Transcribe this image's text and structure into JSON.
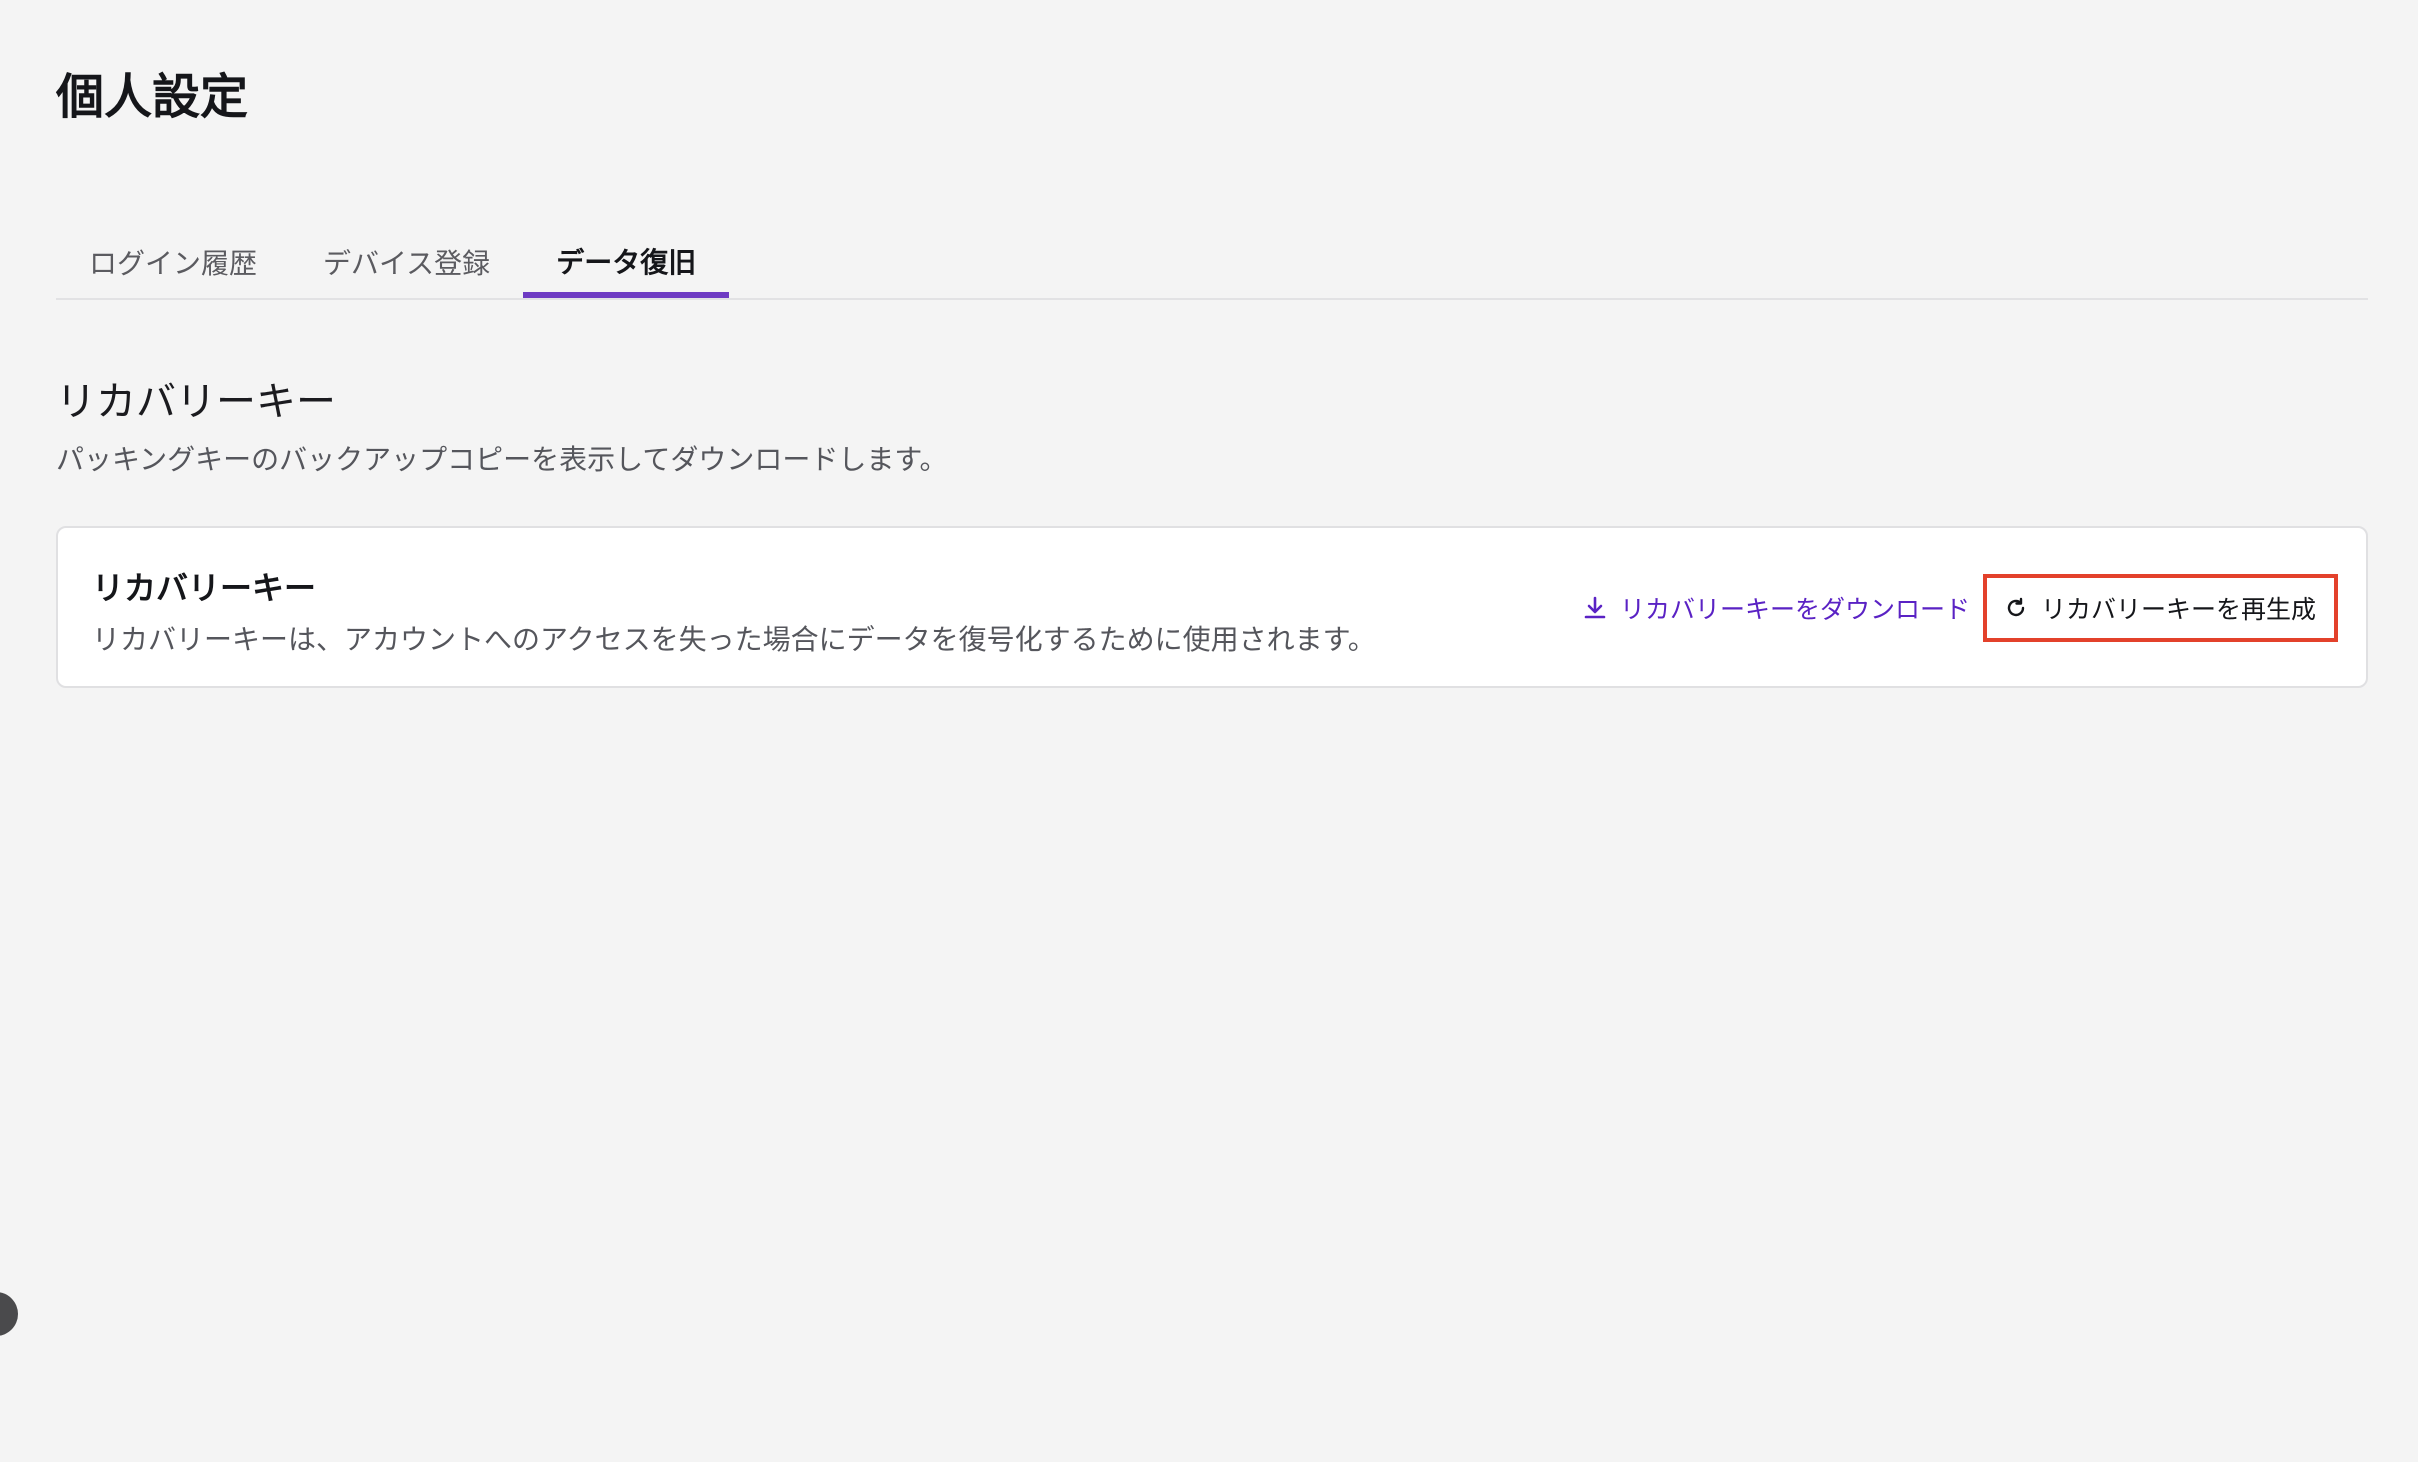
{
  "page": {
    "title": "個人設定"
  },
  "tabs": [
    {
      "label": "ログイン履歴",
      "active": false
    },
    {
      "label": "デバイス登録",
      "active": false
    },
    {
      "label": "データ復旧",
      "active": true
    }
  ],
  "section": {
    "title": "リカバリーキー",
    "description": "パッキングキーのバックアップコピーを表示してダウンロードします。"
  },
  "card": {
    "title": "リカバリーキー",
    "description": "リカバリーキーは、アカウントへのアクセスを失った場合にデータを復号化するために使用されます。",
    "download_label": "リカバリーキーをダウンロード",
    "download_icon": "download-icon",
    "regenerate_label": "リカバリーキーを再生成",
    "regenerate_icon": "refresh-icon"
  },
  "colors": {
    "accent": "#6e3bc3",
    "link": "#5a22c4",
    "highlight_border": "#e3412b",
    "background": "#f4f4f4"
  }
}
